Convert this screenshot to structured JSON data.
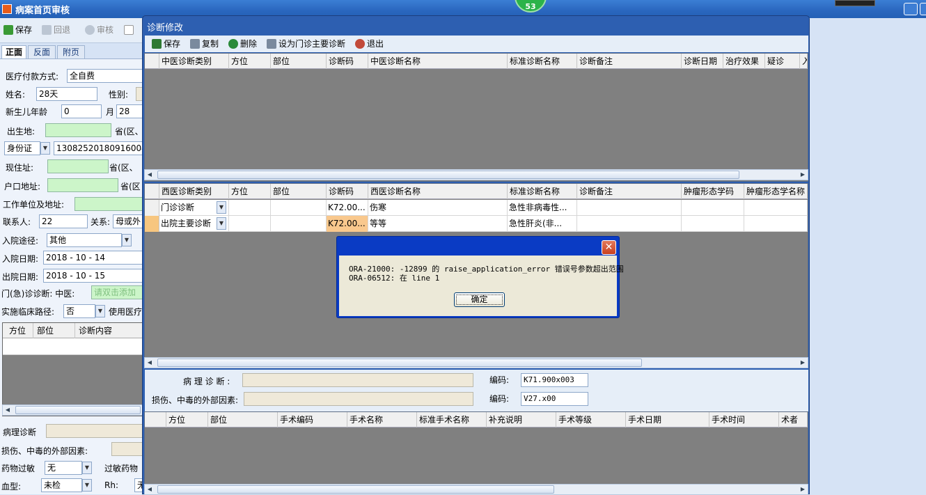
{
  "window": {
    "title": "病案首页审核",
    "badge": "53"
  },
  "main_toolbar": {
    "save": "保存",
    "rollback": "回退",
    "audit": "审核"
  },
  "tabs": [
    "正面",
    "反面",
    "附页"
  ],
  "form": {
    "payment_label": "医疗付款方式:",
    "payment_value": "全自费",
    "name_label": "姓名:",
    "name_value": "28天",
    "gender_label": "性别:",
    "newborn_age_label": "新生儿年龄",
    "newborn_age_value": "0",
    "month_label": "月",
    "month_value": "28",
    "birthplace_label": "出生地:",
    "birthplace_suffix": "省(区、",
    "id_type": "身份证",
    "id_number": "130825201809160041",
    "current_addr_label": "现住址:",
    "current_addr_suffix": "省(区、",
    "hukou_label": "户口地址:",
    "hukou_suffix": "省(区",
    "work_label": "工作单位及地址:",
    "contact_label": "联系人:",
    "contact_value": "22",
    "relation_label": "关系:",
    "relation_value": "母或外",
    "admission_route_label": "入院途径:",
    "admission_route_value": "其他",
    "admission_date_label": "入院日期:",
    "admission_date_value": "2018 - 10 - 14",
    "discharge_date_label": "出院日期:",
    "discharge_date_value": "2018 - 10 - 15",
    "outpatient_label": "门(急)诊诊断: 中医:",
    "outpatient_placeholder": "请双击添加",
    "clinical_path_label": "实施临床路径:",
    "clinical_path_value": "否",
    "use_med_label": "使用医疗",
    "mini_headers": [
      "方位",
      "部位",
      "诊断内容"
    ],
    "pathology_label": "病理诊断",
    "injury_label": "损伤、中毒的外部因素:",
    "allergy_label": "药物过敏",
    "allergy_value": "无",
    "allergy_drug_label": "过敏药物",
    "blood_label": "血型:",
    "blood_value": "未检",
    "rh_label": "Rh:",
    "rh_value": "无"
  },
  "dialog": {
    "title": "诊断修改",
    "toolbar": {
      "save": "保存",
      "copy": "复制",
      "delete": "删除",
      "set_main": "设为门诊主要诊断",
      "exit": "退出"
    },
    "tcm_headers": [
      "中医诊断类别",
      "方位",
      "部位",
      "诊断码",
      "中医诊断名称",
      "标准诊断名称",
      "诊断备注",
      "诊断日期",
      "治疗效果",
      "疑诊",
      "入"
    ],
    "wm_headers": [
      "西医诊断类别",
      "方位",
      "部位",
      "诊断码",
      "西医诊断名称",
      "标准诊断名称",
      "诊断备注",
      "肿瘤形态学码",
      "肿瘤形态学名称"
    ],
    "wm_rows": [
      {
        "category": "门诊诊断",
        "code": "K72.00...",
        "name": "伤寒",
        "std_name": "急性非病毒性..."
      },
      {
        "category": "出院主要诊断",
        "code": "K72.00...",
        "name": "等等",
        "std_name": "急性肝炎(非..."
      }
    ],
    "pathology_label": "病 理 诊 断 :",
    "injury_label": "损伤、中毒的外部因素:",
    "code_label": "编码:",
    "pathology_code": "K71.900x003",
    "injury_code": "V27.x00",
    "surgery_headers": [
      "方位",
      "部位",
      "手术编码",
      "手术名称",
      "标准手术名称",
      "补充说明",
      "手术等级",
      "手术日期",
      "手术时间",
      "术者"
    ]
  },
  "error_box": {
    "line1": "ORA-21000: -12899 的 raise_application_error 错误号参数超出范围",
    "line2": "ORA-06512: 在 line 1",
    "ok": "确定"
  }
}
